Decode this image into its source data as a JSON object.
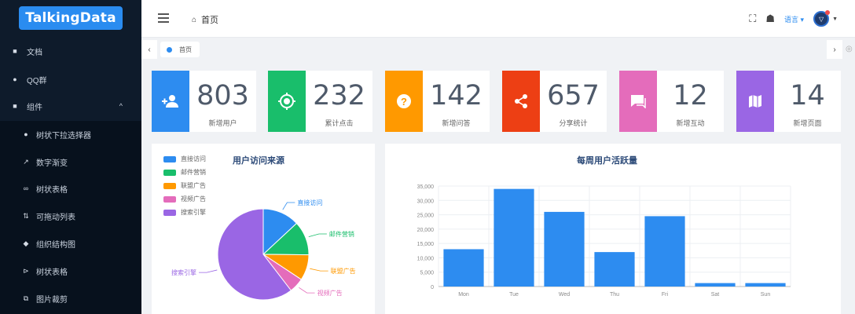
{
  "brand": {
    "name": "TalkingData"
  },
  "sidebar": {
    "items": [
      {
        "icon": "document-icon",
        "glyph": "■",
        "label": "文档"
      },
      {
        "icon": "qq-icon",
        "glyph": "●",
        "label": "QQ群"
      },
      {
        "icon": "component-icon",
        "glyph": "■",
        "label": "组件",
        "caret": "^"
      }
    ],
    "subitems": [
      {
        "icon": "tree-select-icon",
        "glyph": "●",
        "label": "树状下拉选择器"
      },
      {
        "icon": "count-to-icon",
        "glyph": "↗",
        "label": "数字渐变"
      },
      {
        "icon": "tree-table-icon",
        "glyph": "∞",
        "label": "树状表格"
      },
      {
        "icon": "drag-list-icon",
        "glyph": "⇅",
        "label": "可拖动列表"
      },
      {
        "icon": "org-icon",
        "glyph": "◆",
        "label": "组织结构图"
      },
      {
        "icon": "tree-icon",
        "glyph": "⊳",
        "label": "树状表格"
      },
      {
        "icon": "cropper-icon",
        "glyph": "⧉",
        "label": "图片裁剪"
      }
    ]
  },
  "header": {
    "breadcrumb": "首页",
    "lang": "语言"
  },
  "tabs": {
    "items": [
      {
        "label": "首页"
      }
    ]
  },
  "stats": [
    {
      "value": "803",
      "label": "新增用户",
      "color": "#2d8cf0",
      "icon": "add-user-icon",
      "glyph": "👤"
    },
    {
      "value": "232",
      "label": "累计点击",
      "color": "#19be6b",
      "icon": "target-icon",
      "glyph": "◎"
    },
    {
      "value": "142",
      "label": "新增问答",
      "color": "#ff9900",
      "icon": "help-icon",
      "glyph": "?"
    },
    {
      "value": "657",
      "label": "分享统计",
      "color": "#ed3f14",
      "icon": "share-icon",
      "glyph": "<"
    },
    {
      "value": "12",
      "label": "新增互动",
      "color": "#e46cbb",
      "icon": "chat-icon",
      "glyph": "▬"
    },
    {
      "value": "14",
      "label": "新增页面",
      "color": "#9a66e4",
      "icon": "map-icon",
      "glyph": "▮"
    }
  ],
  "pie_panel": {
    "title": "用户访问来源",
    "chart_data": {
      "type": "pie",
      "title": "用户访问来源",
      "categories": [
        "直接访问",
        "邮件营销",
        "联盟广告",
        "视频广告",
        "搜索引擎"
      ],
      "values": [
        335,
        310,
        234,
        135,
        1548
      ],
      "colors": [
        "#2d8cf0",
        "#19be6b",
        "#ff9900",
        "#e46cbb",
        "#9a66e4"
      ],
      "legend_position": "top-left"
    }
  },
  "bar_panel": {
    "title": "每周用户活跃量",
    "chart_data": {
      "type": "bar",
      "title": "每周用户活跃量",
      "categories": [
        "Mon",
        "Tue",
        "Wed",
        "Thu",
        "Fri",
        "Sat",
        "Sun"
      ],
      "values": [
        13000,
        34000,
        26000,
        12000,
        24500,
        1200,
        1200
      ],
      "ylim": [
        0,
        35000
      ],
      "yticks": [
        "0",
        "5,000",
        "10,000",
        "15,000",
        "20,000",
        "25,000",
        "30,000",
        "35,000"
      ],
      "color": "#2d8cf0",
      "grid": true
    }
  }
}
